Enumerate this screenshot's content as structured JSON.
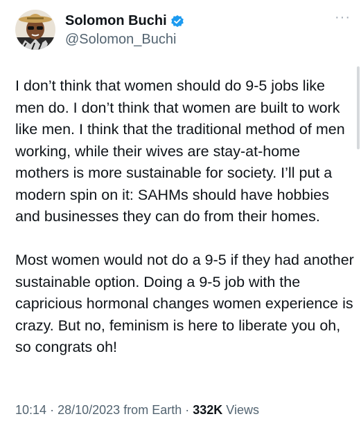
{
  "author": {
    "display_name": "Solomon Buchi",
    "handle": "@Solomon_Buchi",
    "verified": true,
    "verified_color": "#1d9bf0"
  },
  "more_icon": "more-dots-icon",
  "tweet": {
    "paragraphs": [
      "I don’t think that women should do 9-5 jobs like men do. I don’t think that women are built to work like men. I think that the traditional method of men working, while their wives are stay-at-home mothers is more sustainable for society. I’ll put a modern spin on it: SAHMs should have hobbies and businesses they can do from their homes.",
      "Most women would not do a 9-5 if they had another sustainable option. Doing a 9-5 job with the capricious hormonal changes women experience is crazy.  But no, feminism is here to liberate you oh, so congrats oh!"
    ]
  },
  "meta": {
    "time": "10:14",
    "separator": "·",
    "date": "28/10/2023",
    "source": "from Earth",
    "views_count": "332K",
    "views_label": "Views"
  },
  "colors": {
    "text": "#0f1419",
    "muted": "#536471",
    "accent": "#1d9bf0"
  }
}
